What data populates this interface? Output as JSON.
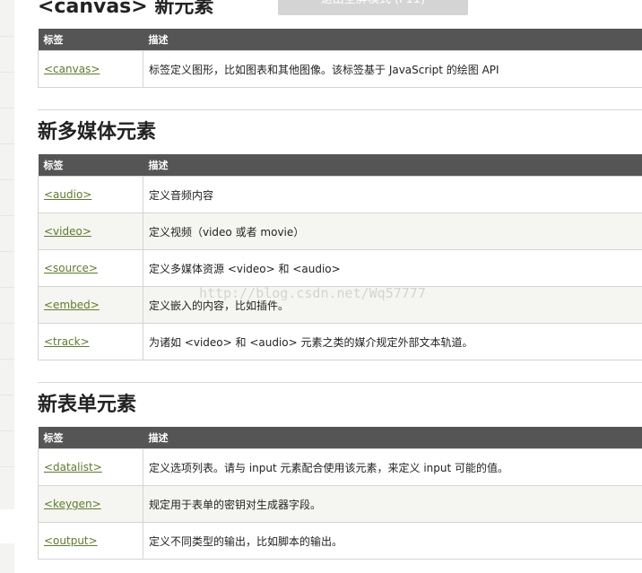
{
  "exit_fullscreen": "退出全屏模式 (F11)",
  "sections": {
    "canvas": {
      "title": "<canvas> 新元素",
      "header": {
        "col1": "标签",
        "col2": "描述"
      },
      "rows": [
        {
          "tag": "<canvas>",
          "desc": "标签定义图形，比如图表和其他图像。该标签基于 JavaScript 的绘图 API"
        }
      ]
    },
    "media": {
      "title": "新多媒体元素",
      "header": {
        "col1": "标签",
        "col2": "描述"
      },
      "rows": [
        {
          "tag": "<audio>",
          "desc": "定义音频内容"
        },
        {
          "tag": "<video>",
          "desc": "定义视频（video 或者 movie）"
        },
        {
          "tag": "<source>",
          "desc": "定义多媒体资源 <video> 和 <audio>"
        },
        {
          "tag": "<embed>",
          "desc": "定义嵌入的内容，比如插件。"
        },
        {
          "tag": "<track>",
          "desc": "为诸如 <video> 和 <audio> 元素之类的媒介规定外部文本轨道。"
        }
      ]
    },
    "form": {
      "title": "新表单元素",
      "header": {
        "col1": "标签",
        "col2": "描述"
      },
      "rows": [
        {
          "tag": "<datalist>",
          "desc": "定义选项列表。请与 input 元素配合使用该元素，来定义 input 可能的值。"
        },
        {
          "tag": "<keygen>",
          "desc": "规定用于表单的密钥对生成器字段。"
        },
        {
          "tag": "<output>",
          "desc": "定义不同类型的输出，比如脚本的输出。"
        }
      ]
    }
  },
  "watermark": "http://blog.csdn.net/Wq57777"
}
